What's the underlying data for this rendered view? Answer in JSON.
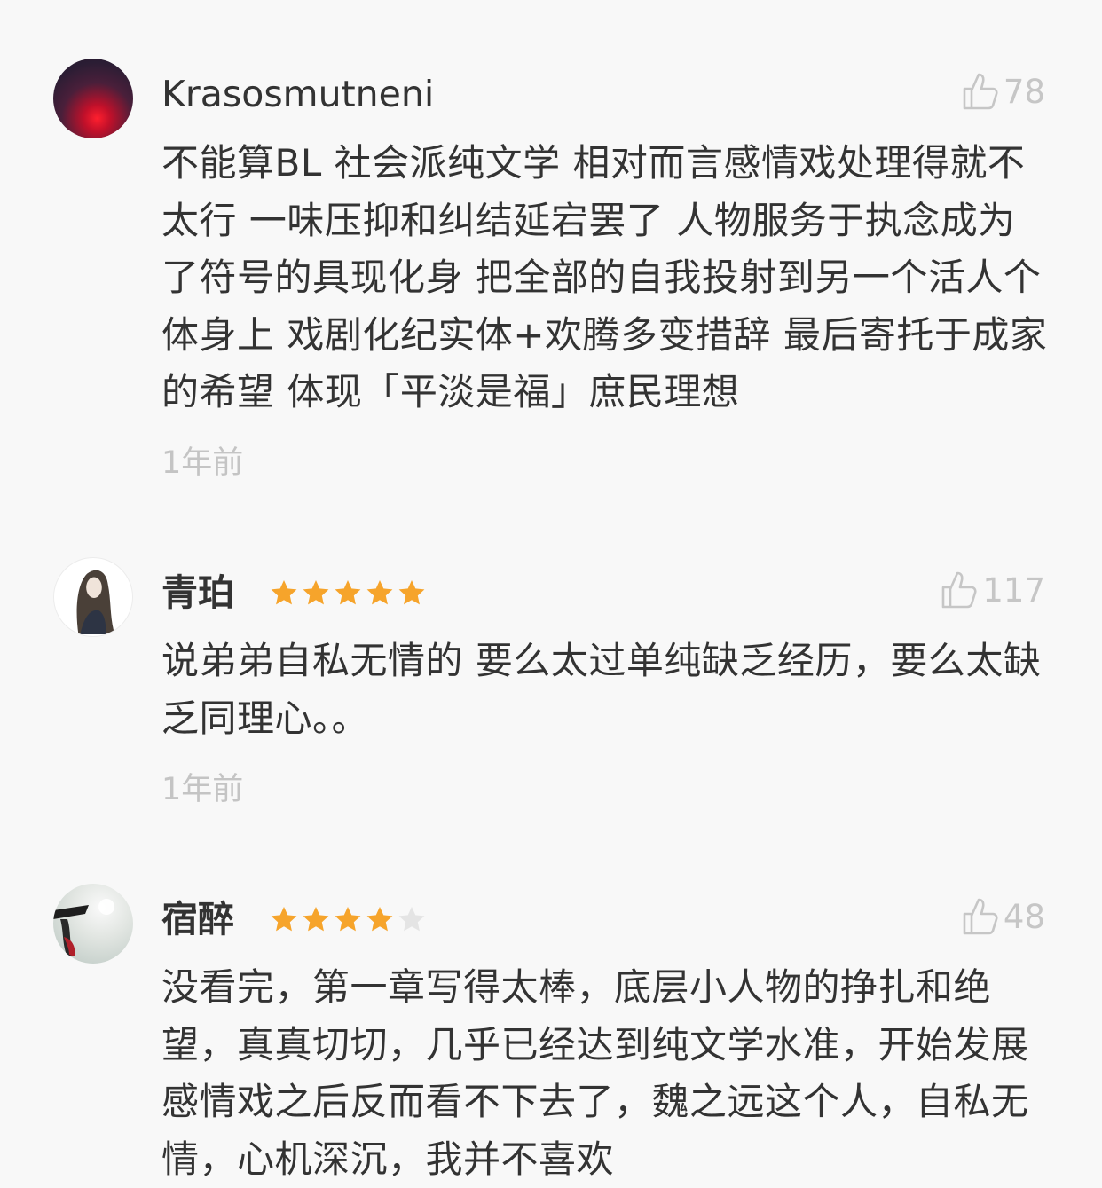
{
  "comments": [
    {
      "username": "Krasosmutneni",
      "rating": null,
      "likes": "78",
      "text": "不能算BL 社会派纯文学 相对而言感情戏处理得就不太行 一味压抑和纠结延宕罢了 人物服务于执念成为了符号的具现化身 把全部的自我投射到另一个活人个体身上 戏剧化纪实体+欢腾多变措辞 最后寄托于成家的希望 体现「平淡是福」庶民理想",
      "time": "1年前"
    },
    {
      "username": "青珀",
      "rating": 5,
      "likes": "117",
      "text": "说弟弟自私无情的 要么太过单纯缺乏经历，要么太缺乏同理心。。",
      "time": "1年前"
    },
    {
      "username": "宿醉",
      "rating": 4,
      "likes": "48",
      "text": "没看完，第一章写得太棒，底层小人物的挣扎和绝望，真真切切，几乎已经达到纯文学水准，开始发展感情戏之后反而看不下去了，魏之远这个人，自私无情，心机深沉，我并不喜欢",
      "time": ""
    }
  ],
  "colors": {
    "star_filled": "#f6a42b",
    "star_empty": "#e4e4e4",
    "muted": "#c6c6c6",
    "text": "#333333"
  },
  "icons": {
    "like": "thumbs-up-icon",
    "star": "star-icon"
  }
}
